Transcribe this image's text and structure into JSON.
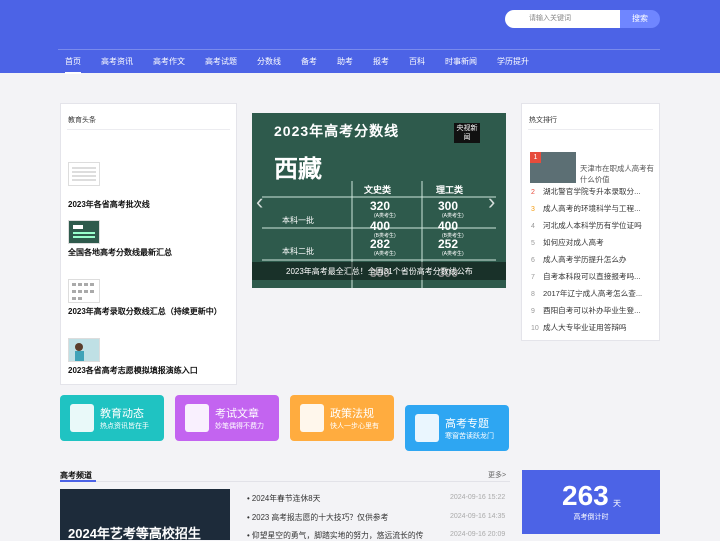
{
  "header": {
    "search_placeholder": "请输入关键词",
    "search_label": "搜索",
    "nav": [
      "首页",
      "高考资讯",
      "高考作文",
      "高考试题",
      "分数线",
      "备考",
      "助考",
      "报考",
      "百科",
      "时事新闻",
      "学历提升"
    ]
  },
  "left_panel": {
    "title": "教育头条",
    "items": [
      "2023年各省高考批次线",
      "全国各地高考分数线最新汇总",
      "2023年高考录取分数线汇总（持续更新中）",
      "2023各省高考志愿模拟填报演练入口"
    ]
  },
  "slider": {
    "headline": "2023年高考分数线",
    "region": "西藏",
    "caption": "2023年高考最全汇总！全国31个省份高考分数线公布",
    "badge": "央视新闻",
    "columns": [
      "文史类",
      "理工类"
    ],
    "rows": [
      {
        "label": "本科一批",
        "values": [
          "320",
          "300"
        ],
        "note": [
          "(A类考生)",
          "(A类考生)"
        ]
      },
      {
        "label": "",
        "values": [
          "400",
          "400"
        ],
        "note": [
          "(B类考生)",
          "(B类考生)"
        ]
      },
      {
        "label": "本科二批",
        "values": [
          "282",
          "252"
        ],
        "note": [
          "(A类考生)",
          "(A类考生)"
        ]
      },
      {
        "label": "",
        "values": [
          "300",
          "300"
        ],
        "note": [
          "(B类考生)",
          "(B类考生)"
        ]
      }
    ]
  },
  "hot": {
    "title": "热文排行",
    "top": {
      "num": "1",
      "text": "天津市在职成人高考有什么价值"
    },
    "items": [
      {
        "num": "2",
        "text": "湖北警官学院专升本录取分..."
      },
      {
        "num": "3",
        "text": "成人高考的环境科学与工程..."
      },
      {
        "num": "4",
        "text": "河北成人本科学历有学位证吗"
      },
      {
        "num": "5",
        "text": "如何应对成人高考"
      },
      {
        "num": "6",
        "text": "成人高考学历提升怎么办"
      },
      {
        "num": "7",
        "text": "自考本科段可以直接报考吗..."
      },
      {
        "num": "8",
        "text": "2017年辽宁成人高考怎么查..."
      },
      {
        "num": "9",
        "text": "酉阳自考可以补办毕业生登..."
      },
      {
        "num": "10",
        "text": "成人大专毕业证用答辩吗"
      }
    ]
  },
  "tiles": [
    {
      "title": "教育动态",
      "sub": "热点资讯皆在手",
      "color": "#1fc3c2"
    },
    {
      "title": "考试文章",
      "sub": "妙笔偶得不费力",
      "color": "#c364f0"
    },
    {
      "title": "政策法规",
      "sub": "快人一步心里有",
      "color": "#ffac3f"
    },
    {
      "title": "高考专题",
      "sub": "寒窗苦读跃龙门",
      "color": "#2ea6f2"
    }
  ],
  "bottom": {
    "title": "高考频道",
    "more": "更多>",
    "image_caption": "2024年艺考等高校招生",
    "list": [
      {
        "text": "2024年春节连休8天",
        "date": "2024-09-16 15:22"
      },
      {
        "text": "2023 高考报志愿的十大技巧？仅供参考",
        "date": "2024-09-16 14:35"
      },
      {
        "text": "仰望星空的勇气，脚踏实地的努力，悠远流长的传",
        "date": "2024-09-16 20:09"
      }
    ],
    "countdown": {
      "days": "263",
      "unit": "天",
      "label": "高考倒计时"
    }
  }
}
